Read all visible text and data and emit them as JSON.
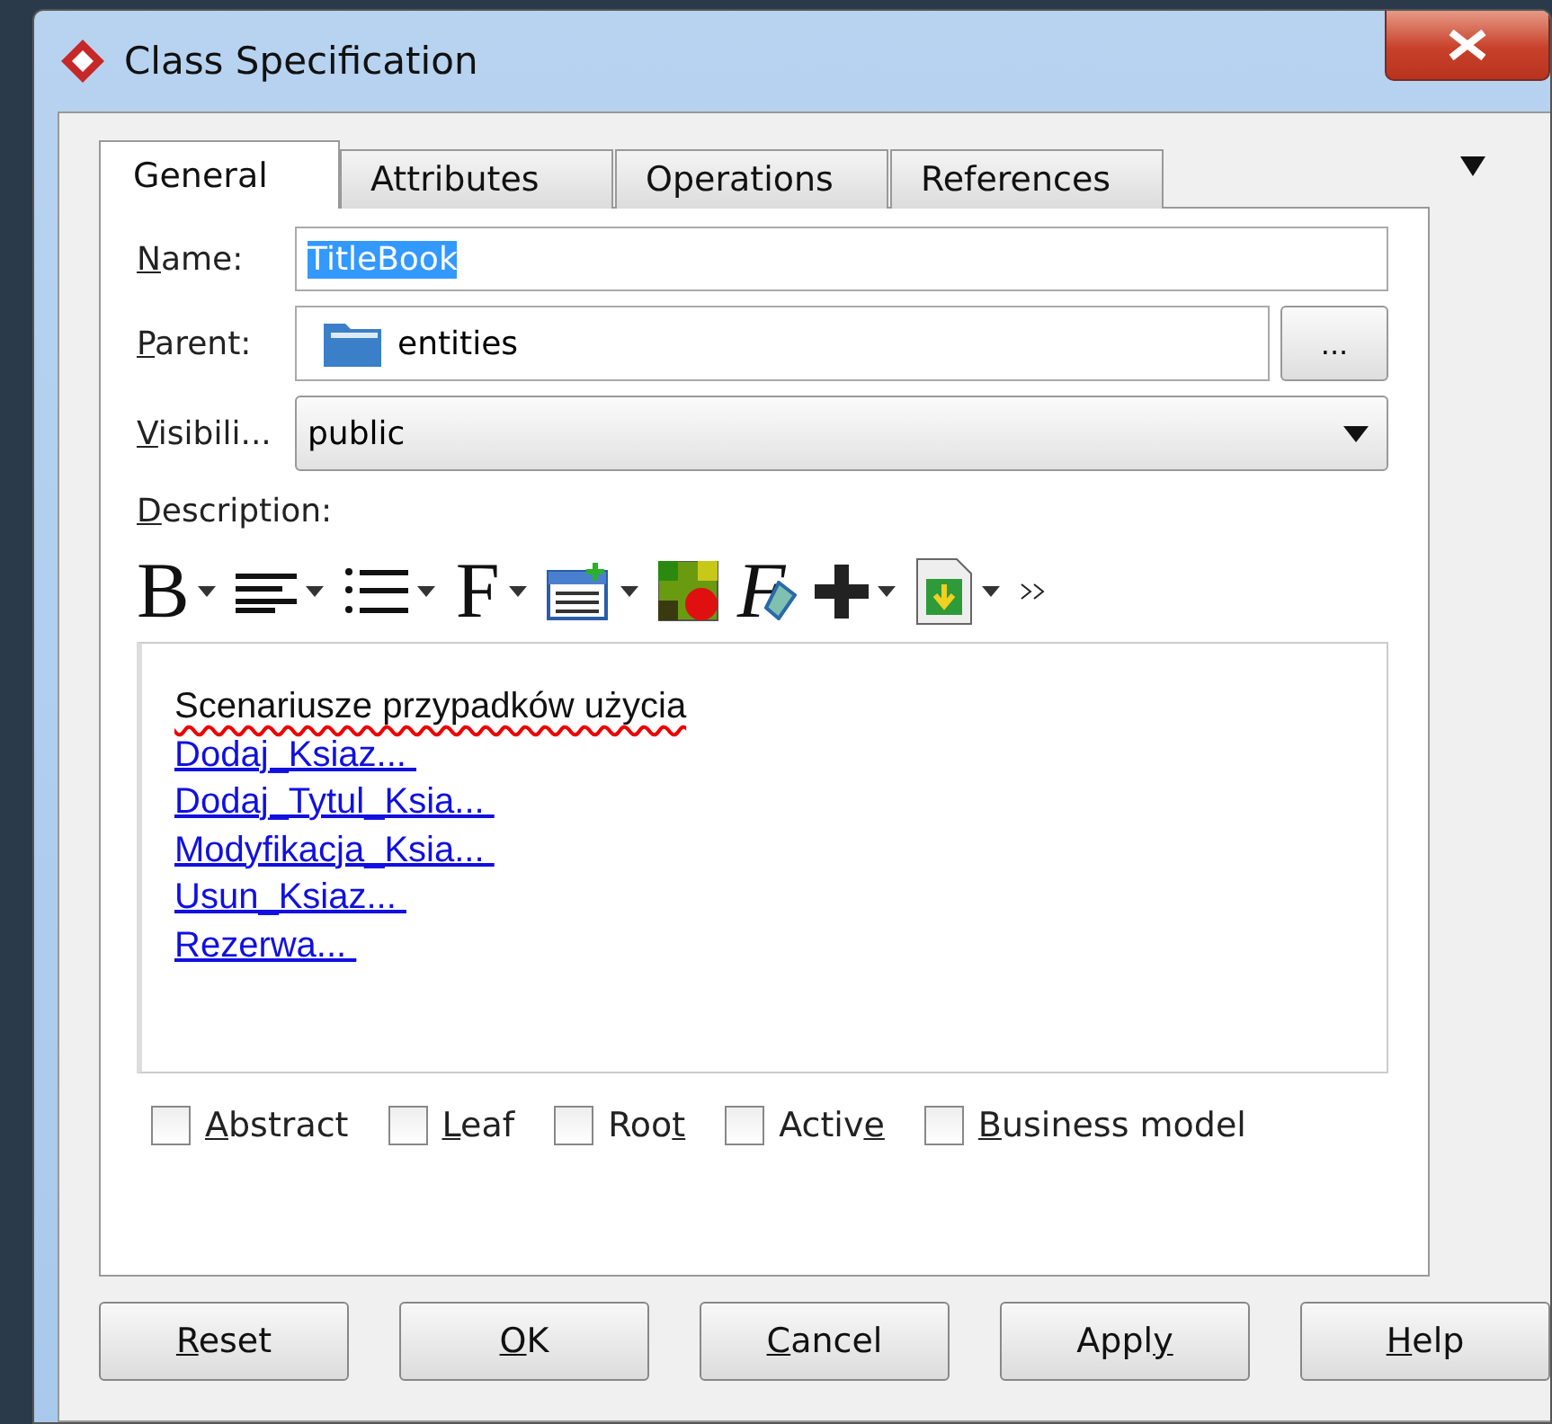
{
  "window": {
    "title": "Class Specification"
  },
  "tabs": [
    {
      "label": "General",
      "selected": true
    },
    {
      "label": "Attributes",
      "selected": false
    },
    {
      "label": "Operations",
      "selected": false
    },
    {
      "label": "References",
      "selected": false
    }
  ],
  "fields": {
    "name": {
      "label": {
        "key": "N",
        "post": "ame:"
      },
      "value": "TitleBook"
    },
    "parent": {
      "label": {
        "key": "P",
        "post": "arent:"
      },
      "value": "entities",
      "button": "..."
    },
    "visibility": {
      "label": {
        "key": "V",
        "post": "isibili..."
      },
      "value": "public"
    }
  },
  "description": {
    "label": {
      "key": "D",
      "post": "escription:"
    },
    "toolbar": [
      {
        "kind": "glyph",
        "glyph": "B",
        "dropdown": true
      },
      {
        "kind": "align",
        "dropdown": true
      },
      {
        "kind": "list",
        "dropdown": true
      },
      {
        "kind": "glyph",
        "glyph": "F",
        "dropdown": true
      },
      {
        "kind": "table",
        "dropdown": true
      },
      {
        "kind": "color",
        "dropdown": false
      },
      {
        "kind": "eraser",
        "glyph": "F",
        "dropdown": false
      },
      {
        "kind": "plus",
        "dropdown": true
      },
      {
        "kind": "import",
        "dropdown": true
      },
      {
        "kind": "more",
        "dropdown": false
      }
    ],
    "lines": [
      {
        "kind": "text",
        "text": "Scenariusze przypadków użycia",
        "misspelled": true
      },
      {
        "kind": "link",
        "text": "Dodaj_Ksiaz... "
      },
      {
        "kind": "link",
        "text": "Dodaj_Tytul_Ksia... "
      },
      {
        "kind": "link",
        "text": "Modyfikacja_Ksia... "
      },
      {
        "kind": "link",
        "text": "Usun_Ksiaz... "
      },
      {
        "kind": "link",
        "text": "Rezerwa... "
      }
    ]
  },
  "options": [
    {
      "label": {
        "key": "A",
        "post": "bstract"
      },
      "checked": false
    },
    {
      "label": {
        "key": "L",
        "post": "eaf"
      },
      "checked": false
    },
    {
      "label": {
        "pre": "Roo",
        "key": "t"
      },
      "checked": false
    },
    {
      "label": {
        "pre": "Activ",
        "key": "e"
      },
      "checked": false
    },
    {
      "label": {
        "key": "B",
        "post": "usiness model"
      },
      "checked": false
    }
  ],
  "buttons": [
    {
      "key": "R",
      "post": "eset"
    },
    {
      "key": "O",
      "post": "K"
    },
    {
      "key": "C",
      "post": "ancel"
    },
    {
      "pre": "Appl",
      "key": "y"
    },
    {
      "key": "H",
      "post": "elp"
    }
  ]
}
